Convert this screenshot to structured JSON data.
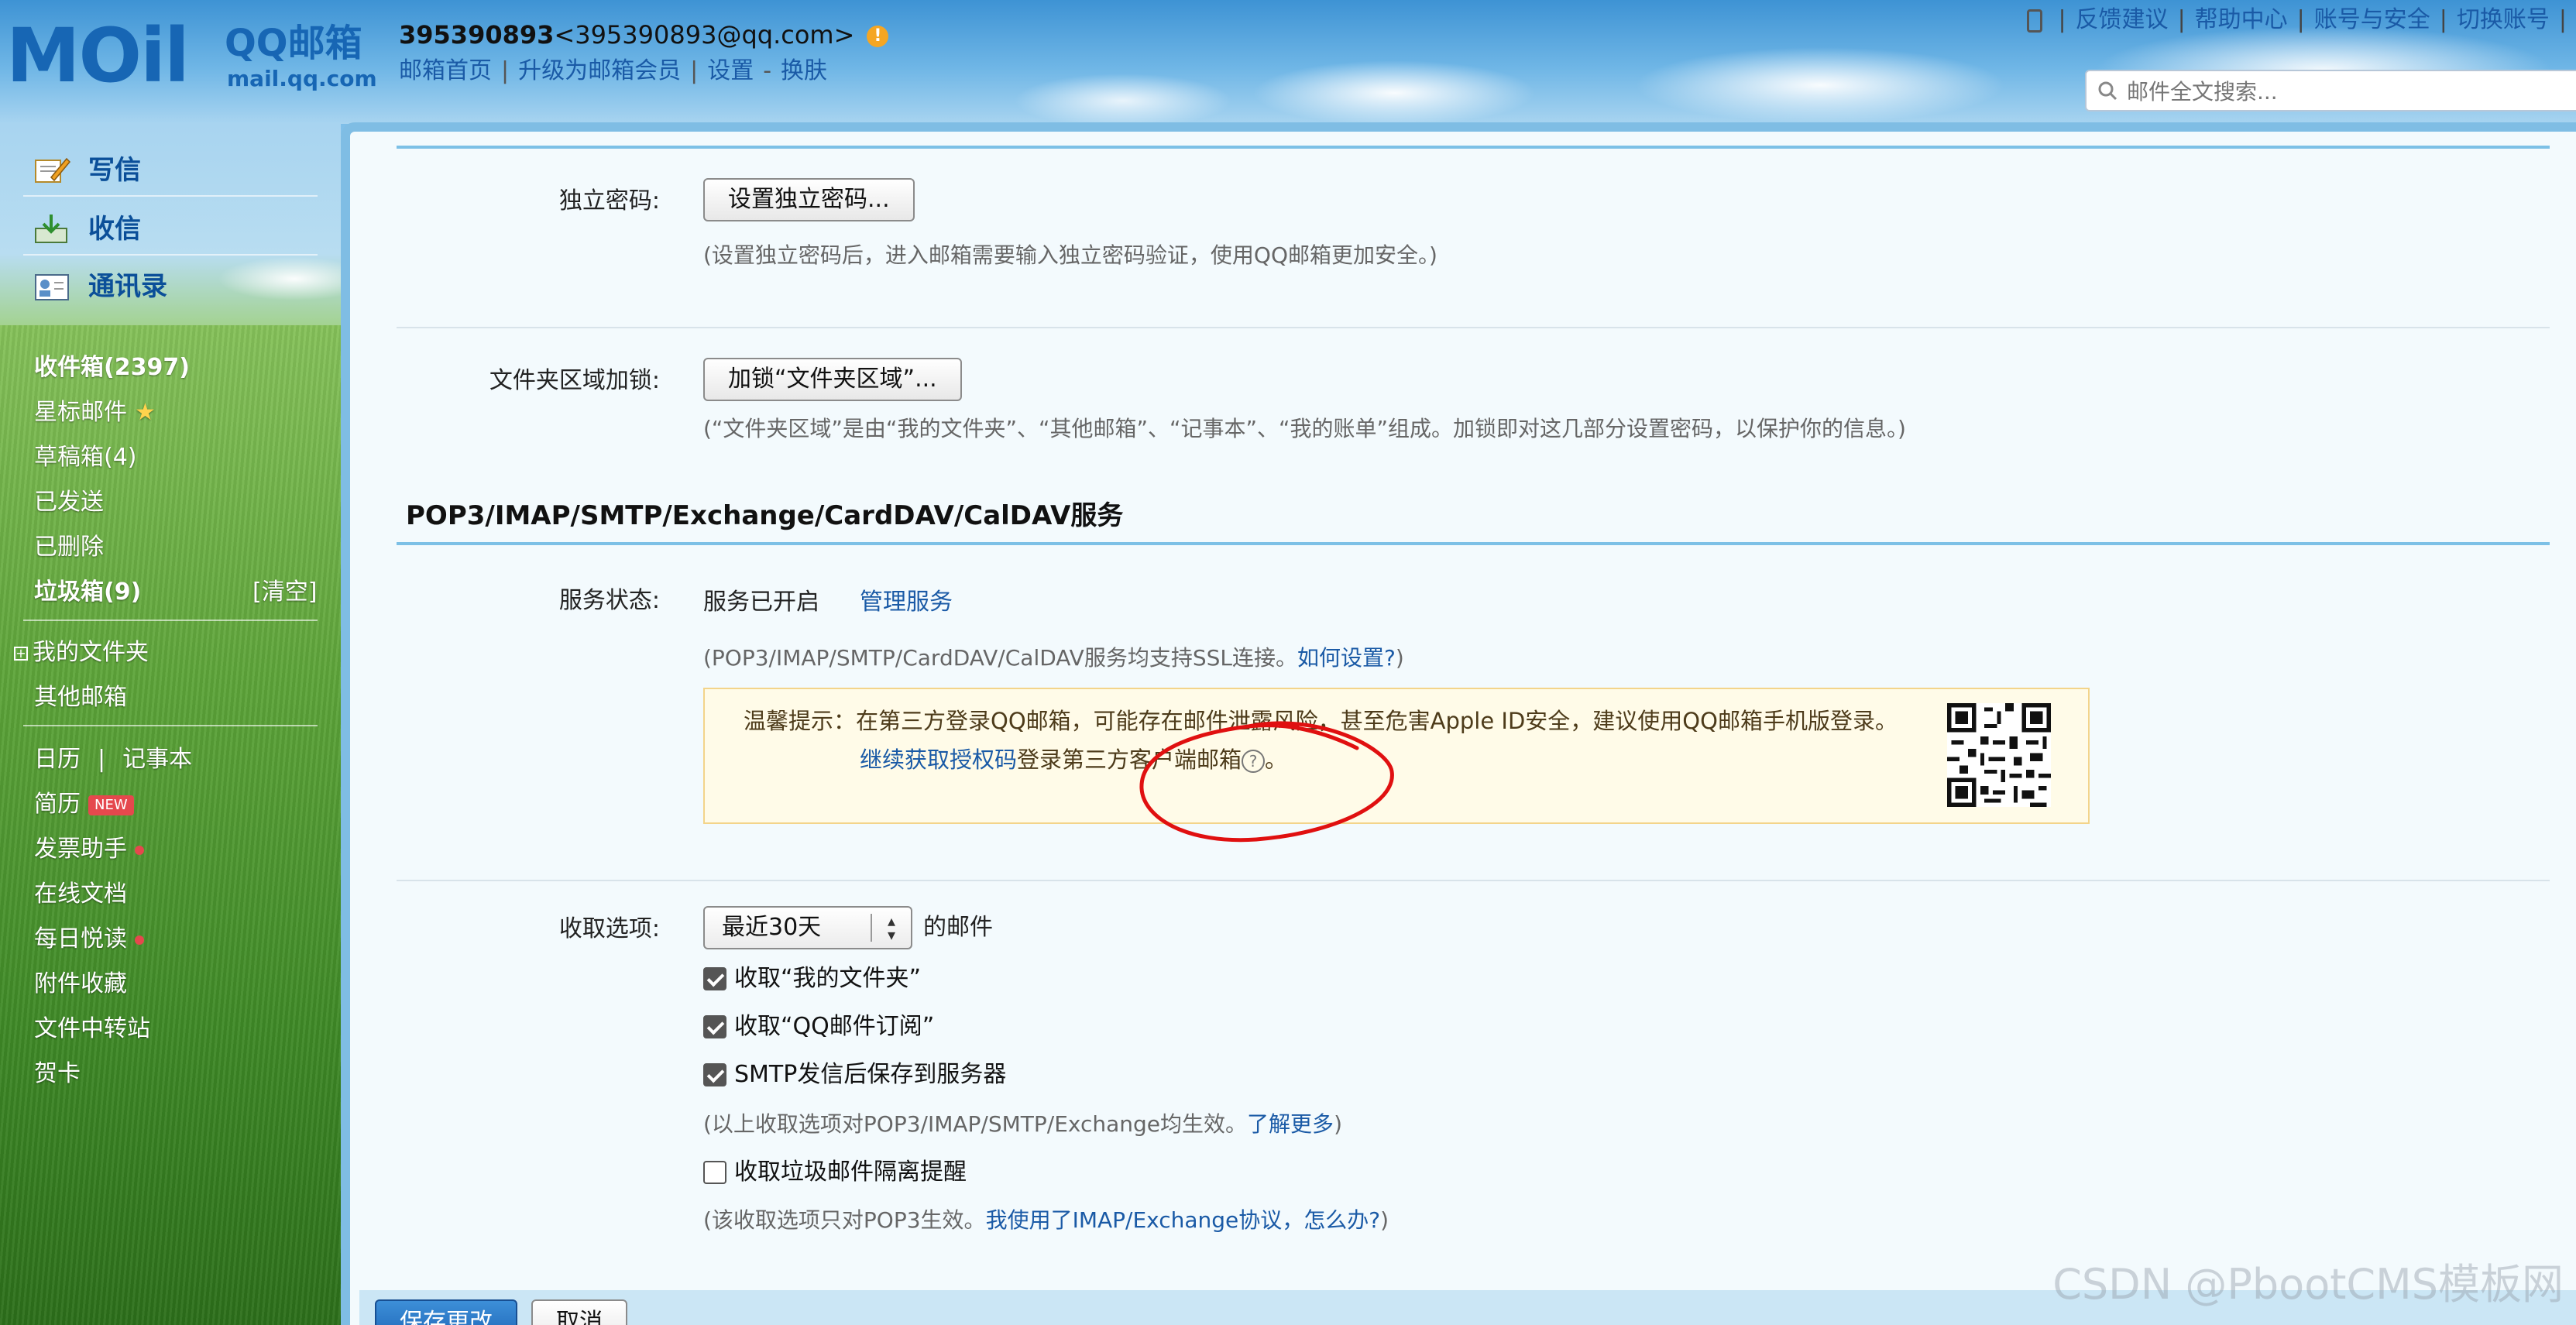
{
  "brand": {
    "logo_text": "MOil",
    "product": "QQ邮箱",
    "domain": "mail.qq.com"
  },
  "account": {
    "qq": "395390893",
    "email": "<395390893@qq.com>",
    "nav": [
      "邮箱首页",
      "升级为邮箱会员",
      "设置",
      "换肤"
    ]
  },
  "topbar": {
    "links": [
      "反馈建议",
      "帮助中心",
      "账号与安全",
      "切换账号"
    ]
  },
  "search": {
    "placeholder": "邮件全文搜索..."
  },
  "sidebar": {
    "compose": "写信",
    "receive": "收信",
    "contacts": "通讯录",
    "folders": {
      "inbox": "收件箱(2397)",
      "starred": "星标邮件",
      "drafts": "草稿箱(4)",
      "sent": "已发送",
      "deleted": "已删除",
      "spam": "垃圾箱(9)",
      "clear": "[清空]",
      "my_folders": "我的文件夹",
      "other_mailbox": "其他邮箱"
    },
    "apps": {
      "calendar": "日历",
      "notes": "记事本",
      "resume": "简历",
      "new_badge": "NEW",
      "invoice": "发票助手",
      "docs": "在线文档",
      "reading": "每日悦读",
      "attachments": "附件收藏",
      "transfer": "文件中转站",
      "cards": "贺卡"
    }
  },
  "settings": {
    "password": {
      "label": "独立密码:",
      "button": "设置独立密码...",
      "hint": "(设置独立密码后，进入邮箱需要输入独立密码验证，使用QQ邮箱更加安全。)"
    },
    "folder_lock": {
      "label": "文件夹区域加锁:",
      "button": "加锁“文件夹区域”...",
      "hint": "(“文件夹区域”是由“我的文件夹”、“其他邮箱”、“记事本”、“我的账单”组成。加锁即对这几部分设置密码，以保护你的信息。)"
    },
    "section_title": "POP3/IMAP/SMTP/Exchange/CardDAV/CalDAV服务",
    "service": {
      "label": "服务状态:",
      "status": "服务已开启",
      "manage": "管理服务",
      "hint_prefix": "(POP3/IMAP/SMTP/CardDAV/CalDAV服务均支持SSL连接。",
      "hint_link": "如何设置?",
      "hint_suffix": ")"
    },
    "notice": {
      "line1": "温馨提示：在第三方登录QQ邮箱，可能存在邮件泄露风险，甚至危害Apple ID安全，建议使用QQ邮箱手机版登录。",
      "link": "继续获取授权码",
      "line2_suffix": "登录第三方客户端邮箱",
      "period": "。"
    },
    "fetch": {
      "label": "收取选项:",
      "selected": "最近30天",
      "after": "的邮件",
      "opt1": "收取“我的文件夹”",
      "opt2": "收取“QQ邮件订阅”",
      "opt3": "SMTP发信后保存到服务器",
      "hint1_prefix": "(以上收取选项对POP3/IMAP/SMTP/Exchange均生效。",
      "hint1_link": "了解更多",
      "hint1_suffix": ")",
      "opt4": "收取垃圾邮件隔离提醒",
      "hint2_prefix": "(该收取选项只对POP3生效。",
      "hint2_link": "我使用了IMAP/Exchange协议，怎么办?",
      "hint2_suffix": ")"
    },
    "save": "保存更改",
    "cancel": "取消"
  },
  "watermark": "CSDN @PbootCMS模板网",
  "colors": {
    "link": "#1a5aa6",
    "brand": "#1766b4",
    "notice_bg": "#fffbe8",
    "annotation": "#e01010"
  }
}
